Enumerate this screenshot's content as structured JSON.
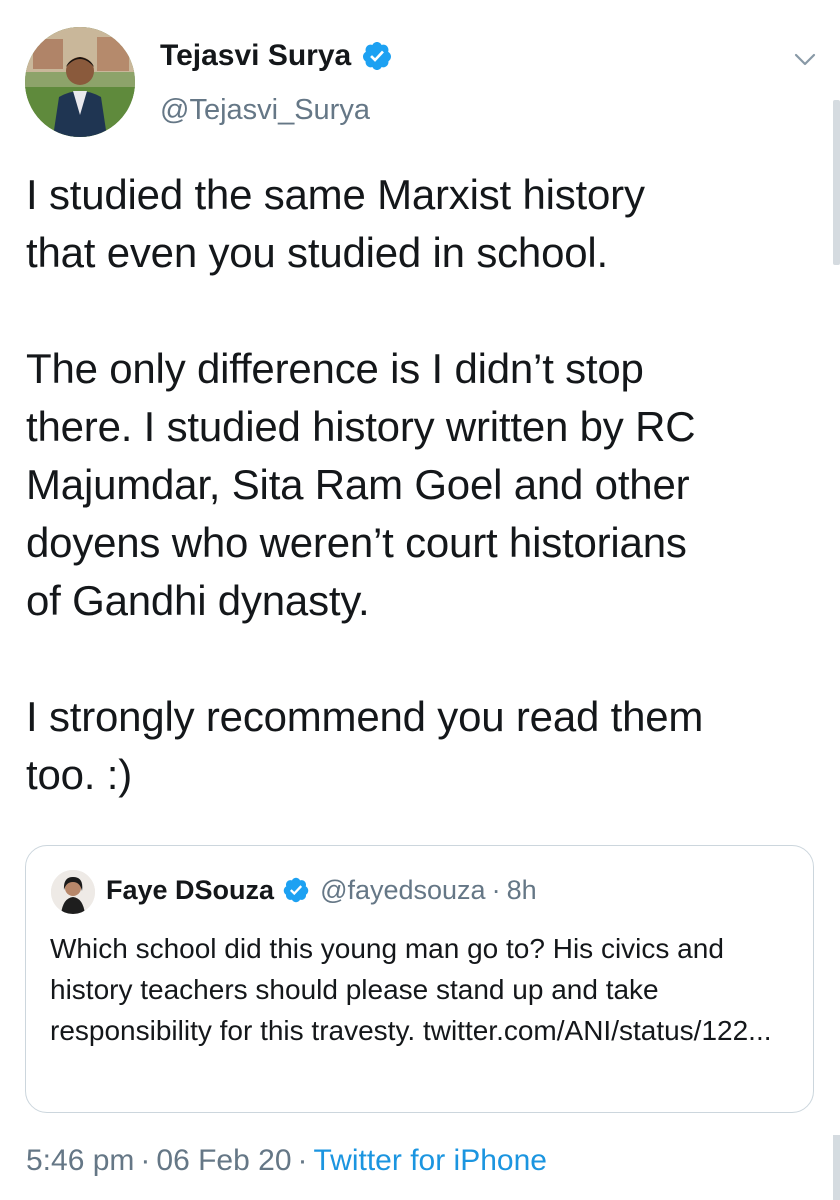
{
  "author": {
    "display_name": "Tejasvi Surya",
    "handle": "@Tejasvi_Surya",
    "verified": true
  },
  "tweet": {
    "paragraphs": [
      "I studied the same Marxist history\nthat even you studied in school.",
      "The only difference is I didn’t stop\nthere. I studied history written by RC\nMajumdar, Sita Ram Goel and other\ndoyens who weren’t court historians\nof Gandhi dynasty.",
      "I strongly recommend you read them\ntoo. :)"
    ]
  },
  "quoted_tweet": {
    "display_name": "Faye DSouza",
    "handle": "@fayedsouza",
    "separator": "·",
    "time": "8h",
    "verified": true,
    "text": "Which school did this young man go to? His civics and history teachers should please stand up and take responsibility for this travesty. twitter.com/ANI/status/122..."
  },
  "meta": {
    "time": "5:46 pm",
    "separator": "·",
    "date": "06 Feb 20",
    "source": "Twitter for iPhone"
  },
  "icons": {
    "verified": "verified-badge-icon",
    "menu": "chevron-down-icon"
  },
  "colors": {
    "link": "#1b95e0",
    "verified": "#1da1f2",
    "secondary_text": "#657786",
    "border": "#ccd6dd"
  }
}
